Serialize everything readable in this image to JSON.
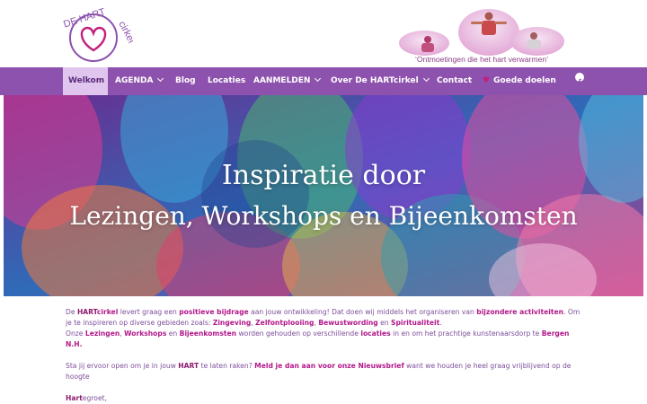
{
  "logo": {
    "text_top": "DE HART",
    "text_side": "cirkel"
  },
  "banner": {
    "slogan": "‘Ontmoetingen die het hart verwarmen’"
  },
  "nav": {
    "items": [
      {
        "label": "Welkom"
      },
      {
        "label": "AGENDA"
      },
      {
        "label": "Blog"
      },
      {
        "label": "Locaties"
      },
      {
        "label": "AANMELDEN"
      },
      {
        "label": "Over De HARTcirkel"
      },
      {
        "label": "Contact"
      },
      {
        "label": "Goede doelen"
      }
    ]
  },
  "hero": {
    "line1": "Inspiratie door",
    "line2": "Lezingen, Workshops en Bijeenkomsten"
  },
  "content": {
    "p1": {
      "a1": "De ",
      "a2": "HART",
      "a3": "cirkel",
      "a4": " levert graag een ",
      "a5": "positieve bijdrage",
      "a6": " aan jouw ontwikkeling! Dat doen wij middels het organiseren van ",
      "a7": "bijzondere activiteiten",
      "a8": ". Om je te inspireren op diverse gebieden zoals: ",
      "a9": "Zingeving",
      "a10": ", ",
      "a11": "Zelfontplooiing",
      "a12": ", ",
      "a13": "Bewustwording",
      "a14": " en ",
      "a15": "Spiritualiteit",
      "a16": "."
    },
    "p2": {
      "b1": "Onze ",
      "b2": "Lezingen",
      "b3": ", ",
      "b4": "Workshops",
      "b5": " en ",
      "b6": "Bijeenkomsten",
      "b7": " worden gehouden op verschillende ",
      "b8": "locaties",
      "b9": " in en om het prachtige kunstenaarsdorp te ",
      "b10": "Bergen N.H."
    },
    "p3": {
      "c1": "Sta jij ervoor open om je in jouw ",
      "c2": "HART",
      "c3": " te laten raken? ",
      "c4": "Meld je dan aan voor onze Nieuwsbrief",
      "c5": " want we houden je heel graag vrijblijvend op de hoogte"
    },
    "p4": {
      "d1": "Hart",
      "d2": "egroet,"
    }
  }
}
